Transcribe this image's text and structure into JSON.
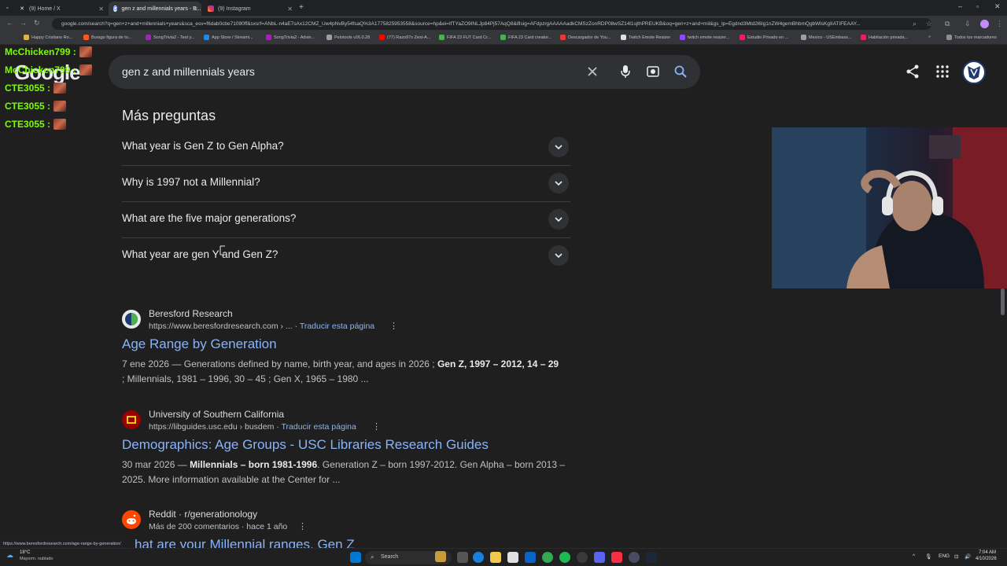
{
  "browser": {
    "tabs": [
      {
        "label": "(9) Home / X",
        "icon": "x-logo-icon"
      },
      {
        "label": "gen z and millennials years - B...",
        "icon": "google-icon"
      },
      {
        "label": "(9) Instagram",
        "icon": "instagram-icon"
      }
    ],
    "url": "google.com/search?q=gen+z+and+millennials+years&sca_esv=f6dab0cbe71090ff&sxsrf=ANbL-n4aE7sAx12CMZ_Uw4pNvBy54fsaQ%3A1775825953558&source=hp&ei=IfTYaZO9INLJp84Pj57AqQ8&iflsig=AFdpzrgAAAAAadkCMSzZonRDP08wSZ14l1sjthPREUKB&oq=gen+z+and+mil&gs_lp=Egdnd3Mtd2l6Ig1nZW4gemBhbmQgbWlsKgIIATIFEAAY...",
    "bookmarks": [
      "Happy Cristiano Ro...",
      "Burago figura de to...",
      "SongTrivia2 - Test y...",
      "App Store / Streami...",
      "SongTrivia2 - Advin...",
      "Pelotools v26.0.28",
      "(77) Razo97s Zest-A...",
      "FIFA 23 FUT Card Cr...",
      "FIFA 23 Card creator...",
      "Descargador de You...",
      "Twitch Emote Resizer",
      "twitch emote resizer...",
      "Estudio Privado en ...",
      "Mexico - USEmbass...",
      "Habitación privada..."
    ],
    "bookmarks_all": "Todos los marcadores"
  },
  "google": {
    "logo": "Google",
    "query": "gen z and millennials years"
  },
  "paa": {
    "title": "Más preguntas",
    "questions": [
      "What year is Gen Z to Gen Alpha?",
      "Why is 1997 not a Millennial?",
      "What are the five major generations?",
      "What year are gen Y and Gen Z?"
    ]
  },
  "results": [
    {
      "site": "Beresford Research",
      "url": "https://www.beresfordresearch.com › ...",
      "translate": "Traducir esta página",
      "title": "Age Range by Generation",
      "date": "7 ene 2026",
      "snippet_pre": "Generations defined by name, birth year, and ages in 2026 ;",
      "snippet_bold": "Gen Z, 1997 – 2012, 14 – 29",
      "snippet_post": "; Millennials, 1981 – 1996, 30 – 45 ; Gen X, 1965 – 1980 ..."
    },
    {
      "site": "University of Southern California",
      "url": "https://libguides.usc.edu › busdem",
      "translate": "Traducir esta página",
      "title": "Demographics: Age Groups - USC Libraries Research Guides",
      "date": "30 mar 2026",
      "snippet_bold": "Millennials – born 1981-1996",
      "snippet_post": ". Generation Z – born 1997-2012. Gen Alpha – born 2013 – 2025. More information available at the Center for ..."
    },
    {
      "site": "Reddit · r/generationology",
      "meta": "Más de 200 comentarios · hace 1 año",
      "title": "hat are your Millennial ranges, Gen Z"
    }
  ],
  "chat": [
    {
      "user": "McChicken799 :",
      "color": "#7cfc00"
    },
    {
      "user": "McChicken799 :",
      "color": "#7cfc00"
    },
    {
      "user": "CTE3055 :",
      "color": "#7cfc00"
    },
    {
      "user": "CTE3055 :",
      "color": "#7cfc00"
    },
    {
      "user": "CTE3055 :",
      "color": "#7cfc00"
    }
  ],
  "status_url": "https://www.beresfordresearch.com/age-range-by-generation/",
  "taskbar": {
    "weather_temp": "18°C",
    "weather_text": "Mayorm. nublado",
    "search_label": "Search",
    "lang": "ENG",
    "time": "7:04 AM",
    "date": "4/10/2026"
  },
  "colors": {
    "background": "#1f1f1f",
    "link": "#8ab4f8",
    "chat_name": "#7cfc00"
  }
}
